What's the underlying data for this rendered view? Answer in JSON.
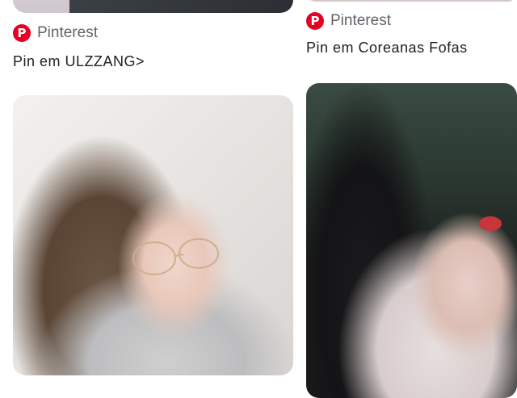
{
  "cards": [
    {
      "source": {
        "icon": "pinterest-logo-icon",
        "label": "Pinterest"
      },
      "title": "Pin em ULZZANG>"
    },
    {
      "source": {
        "icon": "pinterest-logo-icon",
        "label": "Pinterest"
      },
      "title": "Pin em Coreanas Fofas"
    }
  ],
  "colors": {
    "brand": "#e60023",
    "text_primary": "#202124",
    "text_secondary": "#5f6368"
  }
}
